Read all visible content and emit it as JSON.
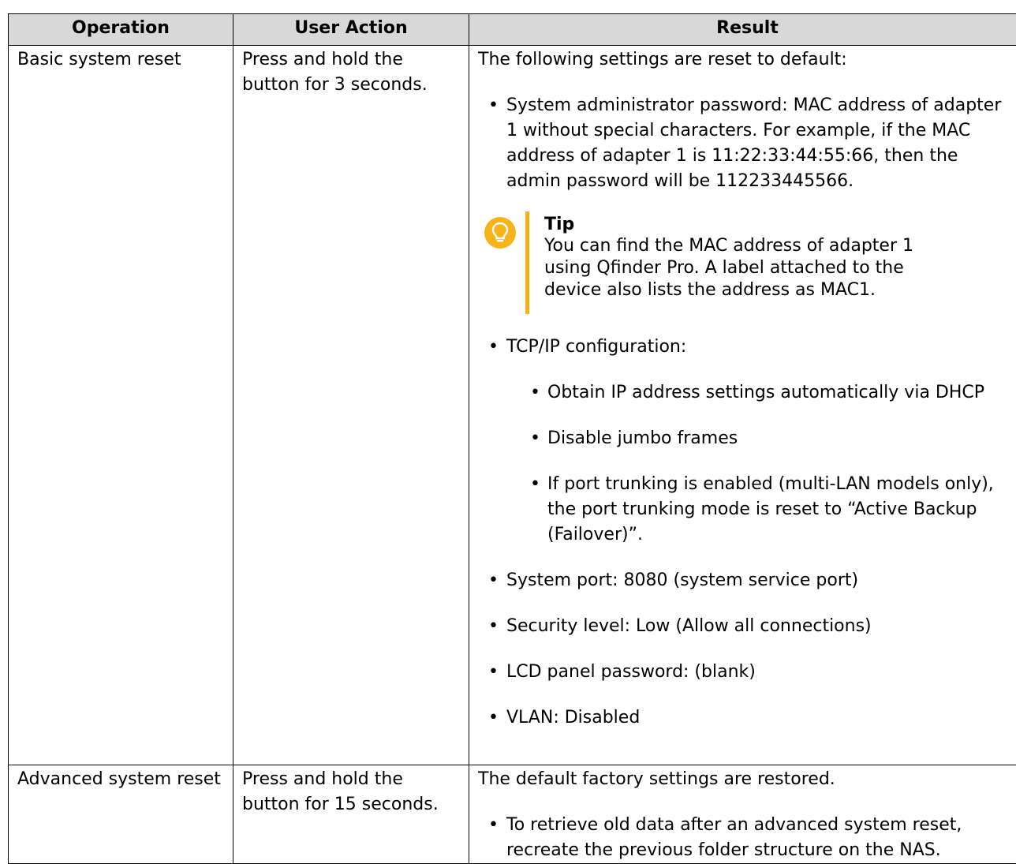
{
  "table": {
    "headers": {
      "operation": "Operation",
      "user_action": "User Action",
      "result": "Result"
    },
    "rows": [
      {
        "operation": "Basic system reset",
        "user_action": "Press and hold the button for 3 seconds.",
        "result_intro": "The following settings are reset to default:",
        "bullets": {
          "admin_password": "System administrator password: MAC address of adapter 1 without special characters. For example, if the MAC address of adapter 1 is 11:22:33:44:55:66, then the admin password will be 112233445566.",
          "tip": {
            "icon": "lightbulb-icon",
            "title": "Tip",
            "body": "You can find the MAC address of adapter 1 using Qfinder Pro. A label attached to the device also lists the address as MAC1."
          },
          "tcpip": "TCP/IP configuration:",
          "tcpip_sub": [
            "Obtain IP address settings automatically via DHCP",
            "Disable jumbo frames",
            "If port trunking is enabled (multi-LAN models only), the port trunking mode is reset to “Active Backup (Failover)”."
          ],
          "system_port": "System port: 8080 (system service port)",
          "security_level": "Security level: Low (Allow all connections)",
          "lcd_password": "LCD panel password: (blank)",
          "vlan": "VLAN: Disabled"
        }
      },
      {
        "operation": "Advanced system reset",
        "user_action": "Press and hold the button for 15 seconds.",
        "result_intro": "The default factory settings are restored.",
        "bullets": {
          "retrieve_data": "To retrieve old data after an advanced system reset, recreate the previous folder structure on the NAS."
        }
      }
    ]
  },
  "colors": {
    "header_bg": "#d8d8d8",
    "border": "#000000",
    "tip_accent": "#f2b21a"
  }
}
